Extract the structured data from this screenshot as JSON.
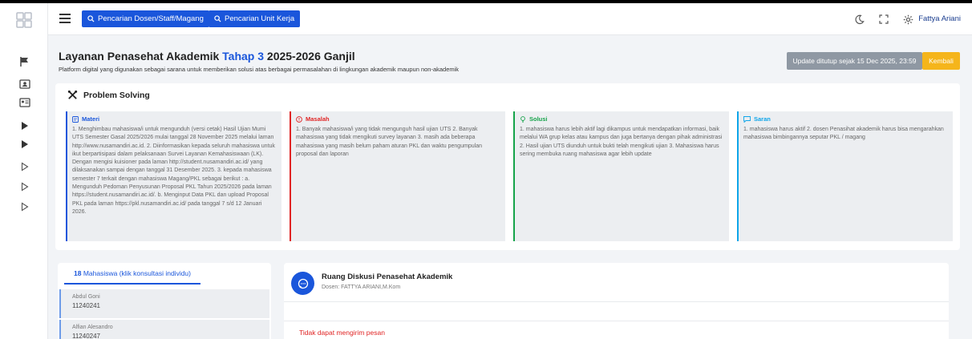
{
  "header": {
    "search_staff_label": "Pencarian Dosen/Staff/Magang",
    "search_unit_label": "Pencarian Unit Kerja",
    "user_name": "Fattya Ariani"
  },
  "page": {
    "title_prefix": "Layanan Penasehat Akademik",
    "title_highlight": "Tahap 3",
    "title_suffix": "2025-2026 Ganjil",
    "subtitle": "Platform digital yang digunakan sebagai sarana untuk memberikan solusi atas berbagai permasalahan di lingkungan akademik maupun non-akademik",
    "status_text": "Update ditutup sejak 15 Dec 2025, 23:59",
    "back_label": "Kembali"
  },
  "problem_solving": {
    "title": "Problem Solving",
    "columns": [
      {
        "label": "Materi",
        "color": "#1a56db",
        "icon": "document-icon",
        "text": "1. Menghimbau mahasiswa/i untuk mengunduh (versi cetak) Hasil Ujian Mumi UTS Semester Gasal 2025/2026 mulai tanggal 28 November 2025 melalui laman http://www.nusamandiri.ac.id. 2. Diinformasikan kepada seluruh mahasiswa untuk ikut berpartisipasi dalam pelaksanaan Survei Layanan Kemahasiswaan (LK). Dengan mengisi kuisioner pada laman http://student.nusamandiri.ac.id/ yang dilaksanakan sampai dengan tanggal 31 Desember 2025. 3. kepada mahasiswa semester 7 terkait dengan mahasiswa Magang/PKL sebagai berikut : a. Mengunduh Pedoman Penyusunan Proposal PKL Tahun 2025/2026 pada laman https://student.nusamandiri.ac.id/. b. Menginput Data PKL dan upload Proposal PKL pada laman https://pkl.nusamandiri.ac.id/ pada tanggal 7 s/d 12 Januari 2026."
      },
      {
        "label": "Masalah",
        "color": "#e02424",
        "icon": "alert-icon",
        "text": "1. Banyak mahasiswa/i yang tidak mengunguh hasil ujian UTS 2. Banyak mahasiswa yang tidak mengikuti survey layanan 3. masih ada beberapa mahasiswa yang masih belum paham aturan PKL dan waktu pengumpulan proposal dan laporan"
      },
      {
        "label": "Solusi",
        "color": "#16a34a",
        "icon": "lightbulb-icon",
        "text": "1. mahasiswa harus lebih aktif lagi dikampus untuk mendapatkan informasi, baik melalui WA grup kelas atau kampus dan juga bertanya dengan pihak administrasi 2. Hasil ujian UTS diunduh untuk bukti telah mengikuti ujian 3. Mahasiswa harus sering membuka ruang mahasiswa agar lebih update"
      },
      {
        "label": "Saran",
        "color": "#0ea5e9",
        "icon": "chat-icon",
        "text": "1. mahasiswa harus aktif 2. dosen Penasihat akademik harus bisa mengarahkan mahasiswa bimbingannya seputar PKL / magang"
      }
    ]
  },
  "students": {
    "count": "18",
    "tab_label": "Mahasiswa (klik konsultasi individu)",
    "items": [
      {
        "name": "Abdul Goni",
        "id": "11240241"
      },
      {
        "name": "Alfian Alesandro",
        "id": "11240247"
      }
    ]
  },
  "discussion": {
    "title": "Ruang Diskusi Penasehat Akademik",
    "lecturer": "Dosen: FATTYA ARIANI,M.Kom",
    "error": "Tidak dapat mengirim pesan"
  }
}
